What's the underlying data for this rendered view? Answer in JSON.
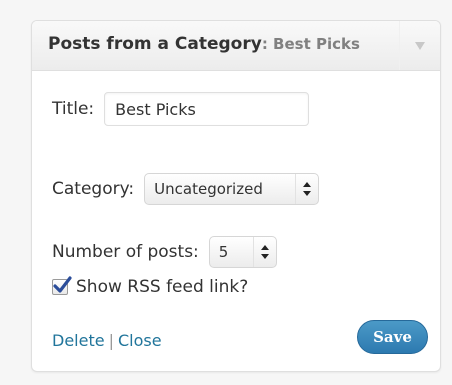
{
  "widget": {
    "title": "Posts from a Category",
    "subtitle": ": Best Picks",
    "toggle_icon": "triangle-down-icon"
  },
  "form": {
    "title_label": "Title:",
    "title_value": "Best Picks",
    "category_label": "Category:",
    "category_value": "Uncategorized",
    "number_label": "Number of posts:",
    "number_value": "5",
    "rss_label": "Show RSS feed link?",
    "rss_checked": true
  },
  "footer": {
    "delete_label": "Delete",
    "separator": "|",
    "close_label": "Close",
    "save_label": "Save"
  },
  "colors": {
    "link": "#21759b",
    "save_button": "#2d7ab0"
  }
}
